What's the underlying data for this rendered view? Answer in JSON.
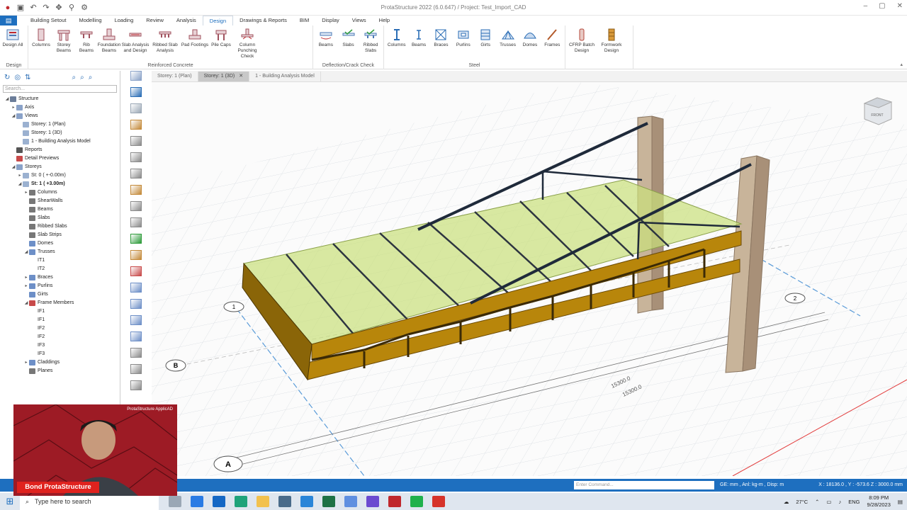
{
  "app": {
    "title": "ProtaStructure 2022 (6.0.647) / Project: Test_Import_CAD",
    "window_controls": [
      "–",
      "▢",
      "✕"
    ]
  },
  "menu": {
    "tabs": [
      "Building Setout",
      "Modelling",
      "Loading",
      "Review",
      "Analysis",
      "Design",
      "Drawings & Reports",
      "BIM",
      "Display",
      "Views",
      "Help"
    ],
    "active": "Design"
  },
  "ribbon": {
    "groups": [
      {
        "title": "Design",
        "buttons": [
          "Design All"
        ]
      },
      {
        "title": "Reinforced Concrete",
        "buttons": [
          "Columns",
          "Storey Beams",
          "Rib Beams",
          "Foundation Beams",
          "Slab Analysis and Design",
          "Ribbed Slab Analysis",
          "Pad Footings",
          "Pile Caps",
          "Column Punching Check"
        ]
      },
      {
        "title": "Deflection/Crack Check",
        "buttons": [
          "Beams",
          "Slabs",
          "Ribbed Slabs"
        ]
      },
      {
        "title": "Steel",
        "buttons": [
          "Columns",
          "Beams",
          "Braces",
          "Purlins",
          "Girts",
          "Trusses",
          "Domes",
          "Frames"
        ]
      },
      {
        "title": "",
        "buttons": [
          "CFRP Batch Design",
          "Formwork Design"
        ]
      }
    ]
  },
  "sidebar": {
    "search_placeholder": "Search...",
    "tree": [
      {
        "label": "Structure",
        "level": 0,
        "exp": "◢",
        "color": "#6b7d99"
      },
      {
        "label": "Axis",
        "level": 1,
        "exp": "▸",
        "color": "#8aa2c8"
      },
      {
        "label": "Views",
        "level": 1,
        "exp": "◢",
        "color": "#8aa2c8"
      },
      {
        "label": "Storey: 1 (Plan)",
        "level": 2,
        "exp": "",
        "color": "#9bb1d0"
      },
      {
        "label": "Storey: 1 (3D)",
        "level": 2,
        "exp": "",
        "color": "#9bb1d0"
      },
      {
        "label": "1 - Building Analysis Model",
        "level": 2,
        "exp": "",
        "color": "#9bb1d0"
      },
      {
        "label": "Reports",
        "level": 1,
        "exp": "",
        "color": "#555"
      },
      {
        "label": "Detail Previews",
        "level": 1,
        "exp": "",
        "color": "#c84a4a"
      },
      {
        "label": "Storeys",
        "level": 1,
        "exp": "◢",
        "color": "#8aa2c8"
      },
      {
        "label": "St: 0 ( +-0.00m)",
        "level": 2,
        "exp": "▸",
        "color": "#9bb1d0"
      },
      {
        "label": "St: 1 ( +3.00m)",
        "level": 2,
        "exp": "◢",
        "color": "#9bb1d0",
        "bold": true
      },
      {
        "label": "Columns",
        "level": 3,
        "exp": "▸",
        "color": "#777"
      },
      {
        "label": "ShearWalls",
        "level": 3,
        "exp": "",
        "color": "#777"
      },
      {
        "label": "Beams",
        "level": 3,
        "exp": "",
        "color": "#777"
      },
      {
        "label": "Slabs",
        "level": 3,
        "exp": "",
        "color": "#777"
      },
      {
        "label": "Ribbed Slabs",
        "level": 3,
        "exp": "",
        "color": "#777"
      },
      {
        "label": "Slab Strips",
        "level": 3,
        "exp": "",
        "color": "#777"
      },
      {
        "label": "Domes",
        "level": 3,
        "exp": "",
        "color": "#6d8fc7"
      },
      {
        "label": "Trusses",
        "level": 3,
        "exp": "◢",
        "color": "#6d8fc7"
      },
      {
        "label": "IT1",
        "level": 4,
        "exp": "",
        "color": ""
      },
      {
        "label": "IT2",
        "level": 4,
        "exp": "",
        "color": ""
      },
      {
        "label": "Braces",
        "level": 3,
        "exp": "▸",
        "color": "#6d8fc7"
      },
      {
        "label": "Purlins",
        "level": 3,
        "exp": "▸",
        "color": "#6d8fc7"
      },
      {
        "label": "Girts",
        "level": 3,
        "exp": "",
        "color": "#6d8fc7"
      },
      {
        "label": "Frame Members",
        "level": 3,
        "exp": "◢",
        "color": "#c84a4a"
      },
      {
        "label": "IF1",
        "level": 4,
        "exp": "",
        "color": ""
      },
      {
        "label": "IF1",
        "level": 4,
        "exp": "",
        "color": ""
      },
      {
        "label": "IF2",
        "level": 4,
        "exp": "",
        "color": ""
      },
      {
        "label": "IF2",
        "level": 4,
        "exp": "",
        "color": ""
      },
      {
        "label": "IF3",
        "level": 4,
        "exp": "",
        "color": ""
      },
      {
        "label": "IF3",
        "level": 4,
        "exp": "",
        "color": ""
      },
      {
        "label": "Claddings",
        "level": 3,
        "exp": "▸",
        "color": "#6d8fc7"
      },
      {
        "label": "Planes",
        "level": 3,
        "exp": "",
        "color": "#777"
      }
    ]
  },
  "doc_tabs": [
    {
      "label": "Storey: 1 (Plan)",
      "active": false
    },
    {
      "label": "Storey: 1 (3D)",
      "active": true,
      "close": "✕"
    },
    {
      "label": "1 - Building Analysis Model",
      "active": false
    }
  ],
  "viewport": {
    "axis_labels": [
      "1",
      "2",
      "A",
      "B"
    ],
    "dimensions": [
      "15300.0",
      "15300.0"
    ],
    "viewcube_label": "FRONT",
    "colors": {
      "slab": "#c9e07a",
      "truss": "#b8860b",
      "steel": "#1f2a3a",
      "column": "#c8b49a",
      "grid": "#d8dde2"
    }
  },
  "status": {
    "command_placeholder": "Enter Command...",
    "units": "GE: mm , Anl: kg-m , Disp: m",
    "coords": "X : 18136.0 , Y : -573.6     Z : 3000.0 mm"
  },
  "webcam": {
    "name": "Bond ProtaStructure",
    "logo": "ProtaStructure  ApplicAD"
  },
  "taskbar": {
    "search_placeholder": "Type here to search",
    "weather": "27°C",
    "lang": "ENG",
    "time": "8:09 PM",
    "date": "9/28/2023"
  }
}
